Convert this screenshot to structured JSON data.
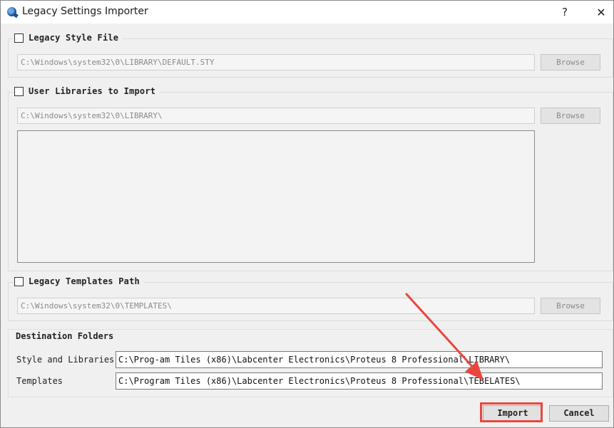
{
  "window": {
    "title": "Legacy Settings Importer",
    "help_glyph": "?",
    "close_glyph": "✕"
  },
  "legacy_style": {
    "label": "Legacy Style File",
    "path": "C:\\Windows\\system32\\0\\LIBRARY\\DEFAULT.STY",
    "browse_label": "Browse"
  },
  "user_libraries": {
    "label": "User Libraries to Import",
    "path": "C:\\Windows\\system32\\0\\LIBRARY\\",
    "browse_label": "Browse"
  },
  "legacy_templates": {
    "label": "Legacy Templates Path",
    "path": "C:\\Windows\\system32\\0\\TEMPLATES\\",
    "browse_label": "Browse"
  },
  "destination": {
    "title": "Destination Folders",
    "style_label": "Style and Libraries",
    "style_value": "C:\\Prog-am Tiles (x86)\\Labcenter Electronics\\Proteus 8 Professional\\LIBRARY\\",
    "templates_label": "Templates",
    "templates_value": "C:\\Program Tiles (x86)\\Labcenter Electronics\\Proteus 8 Professional\\TEBELATES\\"
  },
  "buttons": {
    "import_label": "Import",
    "cancel_label": "Cancel"
  },
  "colors": {
    "annotation": "#e8473f"
  }
}
